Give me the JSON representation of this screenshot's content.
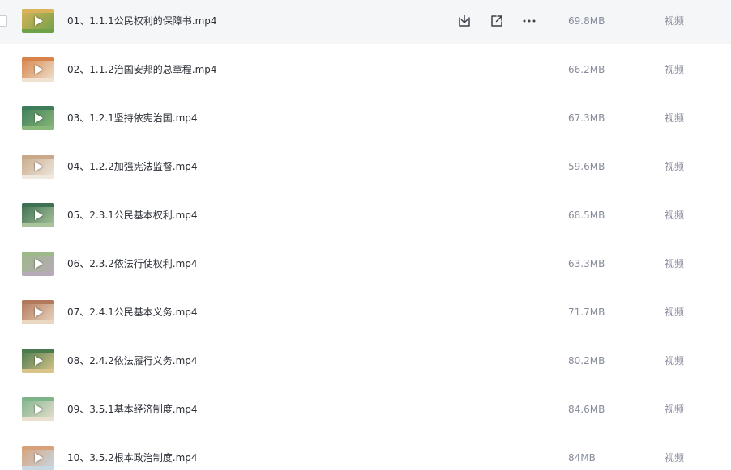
{
  "icons": {
    "download": "download-icon",
    "share": "share-icon",
    "more": "more-icon"
  },
  "files": [
    {
      "name": "01、1.1.1公民权利的保障书.mp4",
      "size": "69.8MB",
      "type": "视频",
      "thumb_colors": [
        "#d9b35a",
        "#6fa14a"
      ]
    },
    {
      "name": "02、1.1.2治国安邦的总章程.mp4",
      "size": "66.2MB",
      "type": "视频",
      "thumb_colors": [
        "#d6844a",
        "#efe3cf"
      ]
    },
    {
      "name": "03、1.2.1坚持依宪治国.mp4",
      "size": "67.3MB",
      "type": "视频",
      "thumb_colors": [
        "#3e7d5a",
        "#8ab87a"
      ]
    },
    {
      "name": "04、1.2.2加强宪法监督.mp4",
      "size": "59.6MB",
      "type": "视频",
      "thumb_colors": [
        "#c9a98a",
        "#efe8df"
      ]
    },
    {
      "name": "05、2.3.1公民基本权利.mp4",
      "size": "68.5MB",
      "type": "视频",
      "thumb_colors": [
        "#3e7052",
        "#a9c49a"
      ]
    },
    {
      "name": "06、2.3.2依法行使权利.mp4",
      "size": "63.3MB",
      "type": "视频",
      "thumb_colors": [
        "#9db889",
        "#b7aab7"
      ]
    },
    {
      "name": "07、2.4.1公民基本义务.mp4",
      "size": "71.7MB",
      "type": "视频",
      "thumb_colors": [
        "#b2785a",
        "#e9d7c2"
      ]
    },
    {
      "name": "08、2.4.2依法履行义务.mp4",
      "size": "80.2MB",
      "type": "视频",
      "thumb_colors": [
        "#4a7a4e",
        "#d9c58a"
      ]
    },
    {
      "name": "09、3.5.1基本经济制度.mp4",
      "size": "84.6MB",
      "type": "视频",
      "thumb_colors": [
        "#7fb38a",
        "#e9e0d0"
      ]
    },
    {
      "name": "10、3.5.2根本政治制度.mp4",
      "size": "84MB",
      "type": "视频",
      "thumb_colors": [
        "#d7a27a",
        "#c9d7e3"
      ]
    }
  ]
}
